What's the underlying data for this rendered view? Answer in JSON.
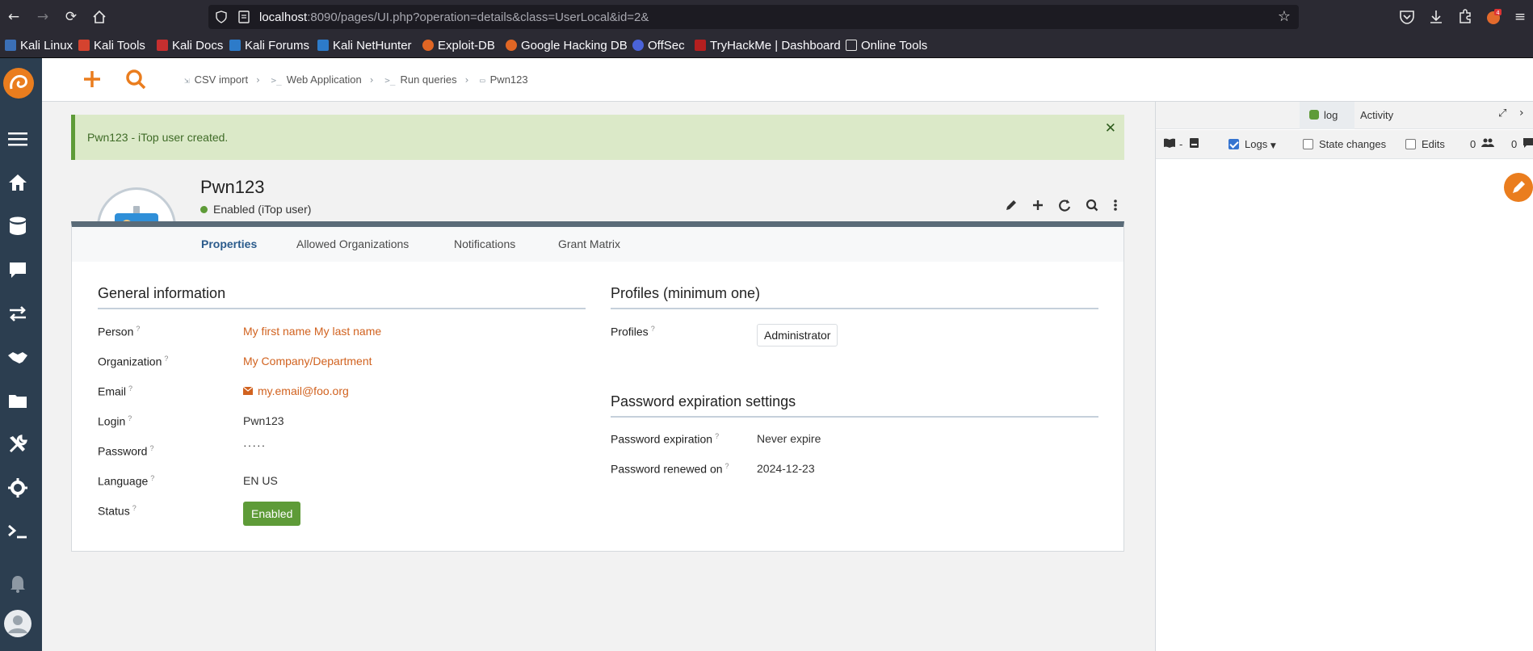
{
  "browser": {
    "url_host": "localhost",
    "url_rest": ":8090/pages/UI.php?operation=details&class=UserLocal&id=2&",
    "bookmarks": [
      "Kali Linux",
      "Kali Tools",
      "Kali Docs",
      "Kali Forums",
      "Kali NetHunter",
      "Exploit-DB",
      "Google Hacking DB",
      "OffSec",
      "TryHackMe | Dashboard",
      "Online Tools"
    ]
  },
  "breadcrumbs": [
    {
      "icon": "file-import-icon",
      "label": "CSV import"
    },
    {
      "icon": "terminal-icon",
      "label": "Web Application"
    },
    {
      "icon": "terminal-icon",
      "label": "Run queries"
    },
    {
      "icon": "user-card-icon",
      "label": "Pwn123"
    }
  ],
  "alert": {
    "message": "Pwn123 - iTop user created."
  },
  "object": {
    "title": "Pwn123",
    "status": "Enabled",
    "status_suffix": "(iTop user)",
    "tabs": [
      "Properties",
      "Allowed Organizations",
      "Notifications",
      "Grant Matrix"
    ]
  },
  "general": {
    "title": "General information",
    "fields": [
      {
        "label": "Person",
        "value": "My first name My last name"
      },
      {
        "label": "Organization",
        "value": "My Company/Department"
      },
      {
        "label": "Email",
        "value": "my.email@foo.org"
      },
      {
        "label": "Login",
        "value": "Pwn123"
      },
      {
        "label": "Password",
        "value": "·····"
      },
      {
        "label": "Language",
        "value": "EN US"
      },
      {
        "label": "Status",
        "value": "Enabled"
      }
    ]
  },
  "profiles": {
    "title": "Profiles (minimum one)",
    "label": "Profiles",
    "value": "Administrator"
  },
  "password_settings": {
    "title": "Password expiration settings",
    "fields": [
      {
        "label": "Password expiration",
        "value": "Never expire"
      },
      {
        "label": "Password renewed on",
        "value": "2024-12-23"
      }
    ]
  },
  "activity": {
    "tab_log": "log",
    "tab_activity": "Activity",
    "toolbar": {
      "book_dash": "-",
      "logs_label": "Logs",
      "state_changes_label": "State changes",
      "edits_label": "Edits",
      "count_1": "0",
      "count_2": "0"
    }
  },
  "colors": {
    "accent": "#ea7d1e",
    "nav": "#2c3e50",
    "success": "#5e9b38",
    "link": "#d1621f"
  }
}
